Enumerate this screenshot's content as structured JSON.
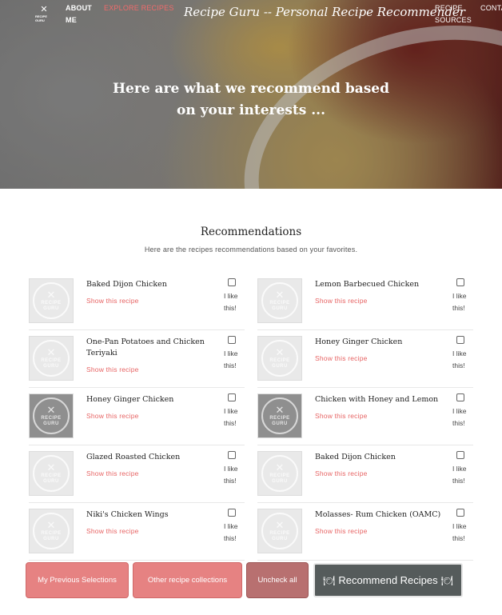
{
  "nav": {
    "logo_text": "RECIPE GURU",
    "logo_icon": "fork-knife-icon",
    "about": "ABOUT ME",
    "explore": "EXPLORE RECIPES",
    "title": "Recipe Guru -- Personal Recipe Recommender",
    "sources": "RECIPE SOURCES",
    "contact": "CONTACT"
  },
  "hero": {
    "heading": "Here are what we recommend based on your interests ..."
  },
  "section": {
    "title": "Recommendations",
    "subtitle": "Here are the recipes recommendations based on your favorites."
  },
  "placeholder": {
    "icon": "fork-knife-icon",
    "text": "RECIPE GURU"
  },
  "show_label": "Show this recipe",
  "like_label": "I like this!",
  "recipes": [
    {
      "name": "Baked Dijon Chicken",
      "thumb": "light"
    },
    {
      "name": "Lemon Barbecued Chicken",
      "thumb": "light"
    },
    {
      "name": "One-Pan Potatoes and Chicken Teriyaki",
      "thumb": "light"
    },
    {
      "name": "Honey Ginger Chicken",
      "thumb": "light"
    },
    {
      "name": "Honey Ginger Chicken",
      "thumb": "dark"
    },
    {
      "name": "Chicken with Honey and Lemon",
      "thumb": "dark"
    },
    {
      "name": "Glazed Roasted Chicken",
      "thumb": "light"
    },
    {
      "name": "Baked Dijon Chicken",
      "thumb": "light"
    },
    {
      "name": "Niki's Chicken Wings",
      "thumb": "light"
    },
    {
      "name": "Molasses- Rum Chicken (OAMC)",
      "thumb": "light"
    }
  ],
  "buttons": {
    "previous": "My Previous Selections",
    "other": "Other recipe collections",
    "uncheck": "Uncheck all",
    "recommend": "Recommend Recipes",
    "recommend_icon": "dish-icon"
  },
  "colors": {
    "accent": "#e76464",
    "button_pink": "#e68282",
    "button_dark": "#555b5b"
  }
}
